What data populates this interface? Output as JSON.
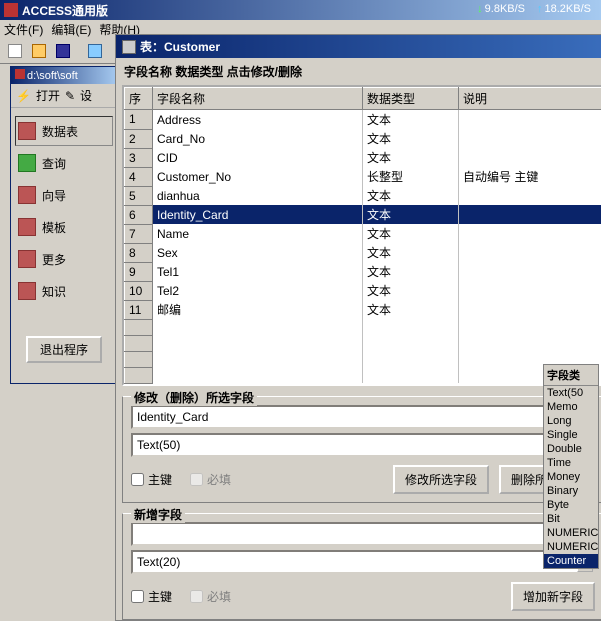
{
  "app": {
    "title": "ACCESS通用版"
  },
  "net": {
    "down": "9.8KB/S",
    "up": "18.2KB/S"
  },
  "menu": {
    "file": "文件(F)",
    "edit": "编辑(E)",
    "help": "帮助(H)"
  },
  "side": {
    "title": "d:\\soft\\soft",
    "open": "打开",
    "design": "设",
    "nav": {
      "table": "数据表",
      "query": "查询",
      "wizard": "向导",
      "template": "模板",
      "more": "更多",
      "knowledge": "知识"
    },
    "exit": "退出程序"
  },
  "tablePanel": {
    "title": "表：Customer",
    "hint": "字段名称 数据类型 点击修改/删除",
    "cols": {
      "seq": "序",
      "name": "字段名称",
      "type": "数据类型",
      "desc": "说明"
    },
    "rows": [
      {
        "seq": "1",
        "name": "Address",
        "type": "文本",
        "desc": ""
      },
      {
        "seq": "2",
        "name": "Card_No",
        "type": "文本",
        "desc": ""
      },
      {
        "seq": "3",
        "name": "CID",
        "type": "文本",
        "desc": ""
      },
      {
        "seq": "4",
        "name": "Customer_No",
        "type": "长整型",
        "desc": "自动编号 主键"
      },
      {
        "seq": "5",
        "name": "dianhua",
        "type": "文本",
        "desc": ""
      },
      {
        "seq": "6",
        "name": "Identity_Card",
        "type": "文本",
        "desc": ""
      },
      {
        "seq": "7",
        "name": "Name",
        "type": "文本",
        "desc": ""
      },
      {
        "seq": "8",
        "name": "Sex",
        "type": "文本",
        "desc": ""
      },
      {
        "seq": "9",
        "name": "Tel1",
        "type": "文本",
        "desc": ""
      },
      {
        "seq": "10",
        "name": "Tel2",
        "type": "文本",
        "desc": ""
      },
      {
        "seq": "11",
        "name": "邮编",
        "type": "文本",
        "desc": ""
      }
    ],
    "selected": 5
  },
  "modify": {
    "legend": "修改（删除）所选字段",
    "fieldName": "Identity_Card",
    "fieldType": "Text(50)",
    "pk": "主键",
    "req": "必填",
    "btnModify": "修改所选字段",
    "btnDelete": "删除所选字段"
  },
  "add": {
    "legend": "新增字段",
    "fieldName": "",
    "fieldType": "Text(20)",
    "pk": "主键",
    "req": "必填",
    "btnAdd": "增加新字段"
  },
  "types": {
    "hdr": "字段类",
    "list": [
      "Text(50",
      "Memo",
      "Long",
      "Single",
      "Double",
      "Time",
      "Money",
      "Binary",
      "Byte",
      "Bit",
      "NUMERIC",
      "NUMERIC",
      "Counter"
    ]
  }
}
